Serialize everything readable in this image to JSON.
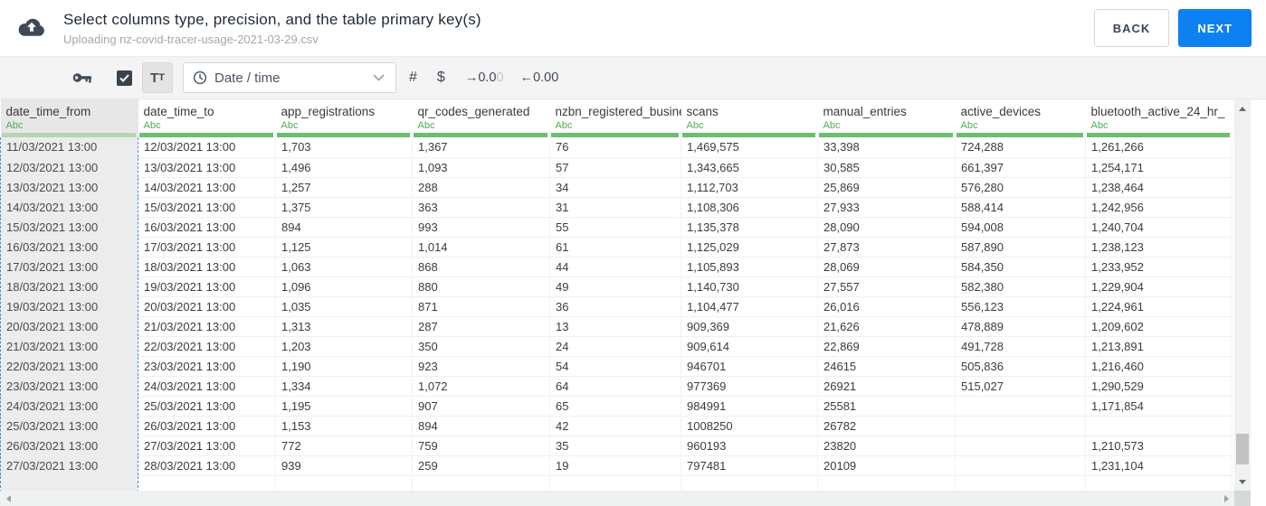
{
  "header": {
    "title": "Select columns type, precision, and the table primary key(s)",
    "subtitle": "Uploading nz-covid-tracer-usage-2021-03-29.csv",
    "back_label": "BACK",
    "next_label": "NEXT"
  },
  "toolbar": {
    "primary_key_icon": "key-icon",
    "checkbox_checked": true,
    "text_type": {
      "large": "T",
      "small": "T"
    },
    "type_dropdown": {
      "icon": "clock-icon",
      "value": "Date / time"
    },
    "number_symbol": "#",
    "currency_symbol": "$",
    "decimal_right": {
      "dark": "→0.0",
      "faded": "0"
    },
    "decimal_left": "←0.00"
  },
  "table": {
    "columns": [
      {
        "name": "date_time_from",
        "type_badge": "Abc",
        "selected": true
      },
      {
        "name": "date_time_to",
        "type_badge": "Abc",
        "selected": false
      },
      {
        "name": "app_registrations",
        "type_badge": "Abc",
        "selected": false
      },
      {
        "name": "qr_codes_generated",
        "type_badge": "Abc",
        "selected": false
      },
      {
        "name": "nzbn_registered_busine",
        "type_badge": "Abc",
        "selected": false
      },
      {
        "name": "scans",
        "type_badge": "Abc",
        "selected": false
      },
      {
        "name": "manual_entries",
        "type_badge": "Abc",
        "selected": false
      },
      {
        "name": "active_devices",
        "type_badge": "Abc",
        "selected": false
      },
      {
        "name": "bluetooth_active_24_hr_",
        "type_badge": "Abc",
        "selected": false
      }
    ],
    "rows": [
      [
        "11/03/2021 13:00",
        "12/03/2021 13:00",
        "1,703",
        "1,367",
        "76",
        "1,469,575",
        "33,398",
        "724,288",
        "1,261,266"
      ],
      [
        "12/03/2021 13:00",
        "13/03/2021 13:00",
        "1,496",
        "1,093",
        "57",
        "1,343,665",
        "30,585",
        "661,397",
        "1,254,171"
      ],
      [
        "13/03/2021 13:00",
        "14/03/2021 13:00",
        "1,257",
        "288",
        "34",
        "1,112,703",
        "25,869",
        "576,280",
        "1,238,464"
      ],
      [
        "14/03/2021 13:00",
        "15/03/2021 13:00",
        "1,375",
        "363",
        "31",
        "1,108,306",
        "27,933",
        "588,414",
        "1,242,956"
      ],
      [
        "15/03/2021 13:00",
        "16/03/2021 13:00",
        "894",
        "993",
        "55",
        "1,135,378",
        "28,090",
        "594,008",
        "1,240,704"
      ],
      [
        "16/03/2021 13:00",
        "17/03/2021 13:00",
        "1,125",
        "1,014",
        "61",
        "1,125,029",
        "27,873",
        "587,890",
        "1,238,123"
      ],
      [
        "17/03/2021 13:00",
        "18/03/2021 13:00",
        "1,063",
        "868",
        "44",
        "1,105,893",
        "28,069",
        "584,350",
        "1,233,952"
      ],
      [
        "18/03/2021 13:00",
        "19/03/2021 13:00",
        "1,096",
        "880",
        "49",
        "1,140,730",
        "27,557",
        "582,380",
        "1,229,904"
      ],
      [
        "19/03/2021 13:00",
        "20/03/2021 13:00",
        "1,035",
        "871",
        "36",
        "1,104,477",
        "26,016",
        "556,123",
        "1,224,961"
      ],
      [
        "20/03/2021 13:00",
        "21/03/2021 13:00",
        "1,313",
        "287",
        "13",
        "909,369",
        "21,626",
        "478,889",
        "1,209,602"
      ],
      [
        "21/03/2021 13:00",
        "22/03/2021 13:00",
        "1,203",
        "350",
        "24",
        "909,614",
        "22,869",
        "491,728",
        "1,213,891"
      ],
      [
        "22/03/2021 13:00",
        "23/03/2021 13:00",
        "1,190",
        "923",
        "54",
        "946701",
        "24615",
        "505,836",
        "1,216,460"
      ],
      [
        "23/03/2021 13:00",
        "24/03/2021 13:00",
        "1,334",
        "1,072",
        "64",
        "977369",
        "26921",
        "515,027",
        "1,290,529"
      ],
      [
        "24/03/2021 13:00",
        "25/03/2021 13:00",
        "1,195",
        "907",
        "65",
        "984991",
        "25581",
        "",
        "1,171,854"
      ],
      [
        "25/03/2021 13:00",
        "26/03/2021 13:00",
        "1,153",
        "894",
        "42",
        "1008250",
        "26782",
        "",
        ""
      ],
      [
        "26/03/2021 13:00",
        "27/03/2021 13:00",
        "772",
        "759",
        "35",
        "960193",
        "23820",
        "",
        "1,210,573"
      ],
      [
        "27/03/2021 13:00",
        "28/03/2021 13:00",
        "939",
        "259",
        "19",
        "797481",
        "20109",
        "",
        "1,231,104"
      ]
    ]
  },
  "colors": {
    "accent_blue": "#0d80f2",
    "type_green": "#4caf50",
    "header_underline_green": "#6cbf6c",
    "selection_dashed_blue": "#4f8fd6",
    "icon_slate": "#3e4a57"
  }
}
